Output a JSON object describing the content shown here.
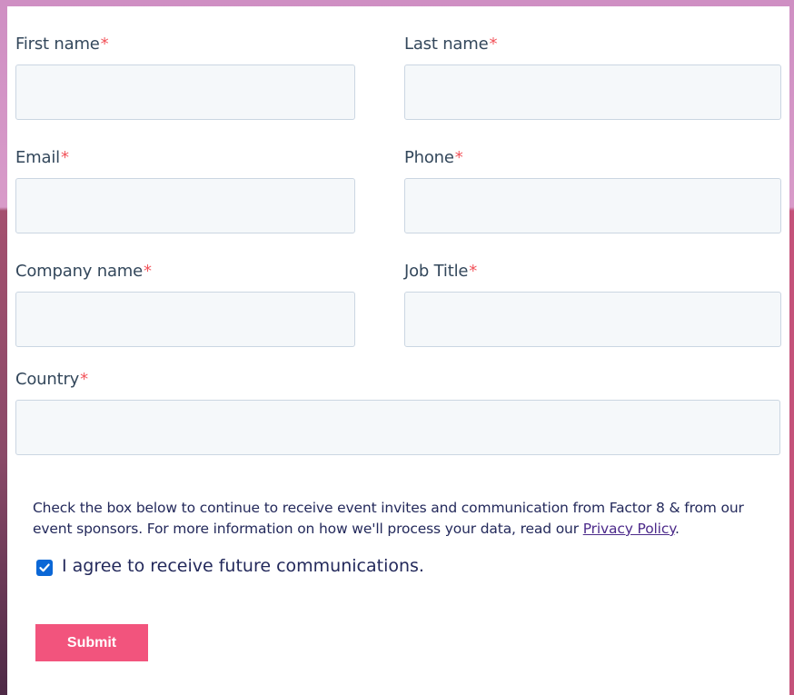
{
  "form": {
    "fields": {
      "first_name": {
        "label": "First name",
        "required_mark": "*",
        "value": ""
      },
      "last_name": {
        "label": "Last name",
        "required_mark": "*",
        "value": ""
      },
      "email": {
        "label": "Email",
        "required_mark": "*",
        "value": ""
      },
      "phone": {
        "label": "Phone",
        "required_mark": "*",
        "value": ""
      },
      "company_name": {
        "label": "Company name",
        "required_mark": "*",
        "value": ""
      },
      "job_title": {
        "label": "Job Title",
        "required_mark": "*",
        "value": ""
      },
      "country": {
        "label": "Country",
        "required_mark": "*",
        "value": ""
      }
    },
    "consent": {
      "text_before_link": "Check the box below to continue to receive event invites and communication from Factor 8 & from our event sponsors. For more information on how we'll process your data, read our ",
      "link_label": "Privacy Policy",
      "text_after_link": ".",
      "checkbox_label": "I agree to receive future communications.",
      "checked": true
    },
    "submit_label": "Submit"
  },
  "colors": {
    "accent": "#f2547d",
    "required": "#f2545b",
    "checkbox": "#0b67d6",
    "input_background": "#f5f8fa",
    "input_border": "#cbd6e2"
  }
}
